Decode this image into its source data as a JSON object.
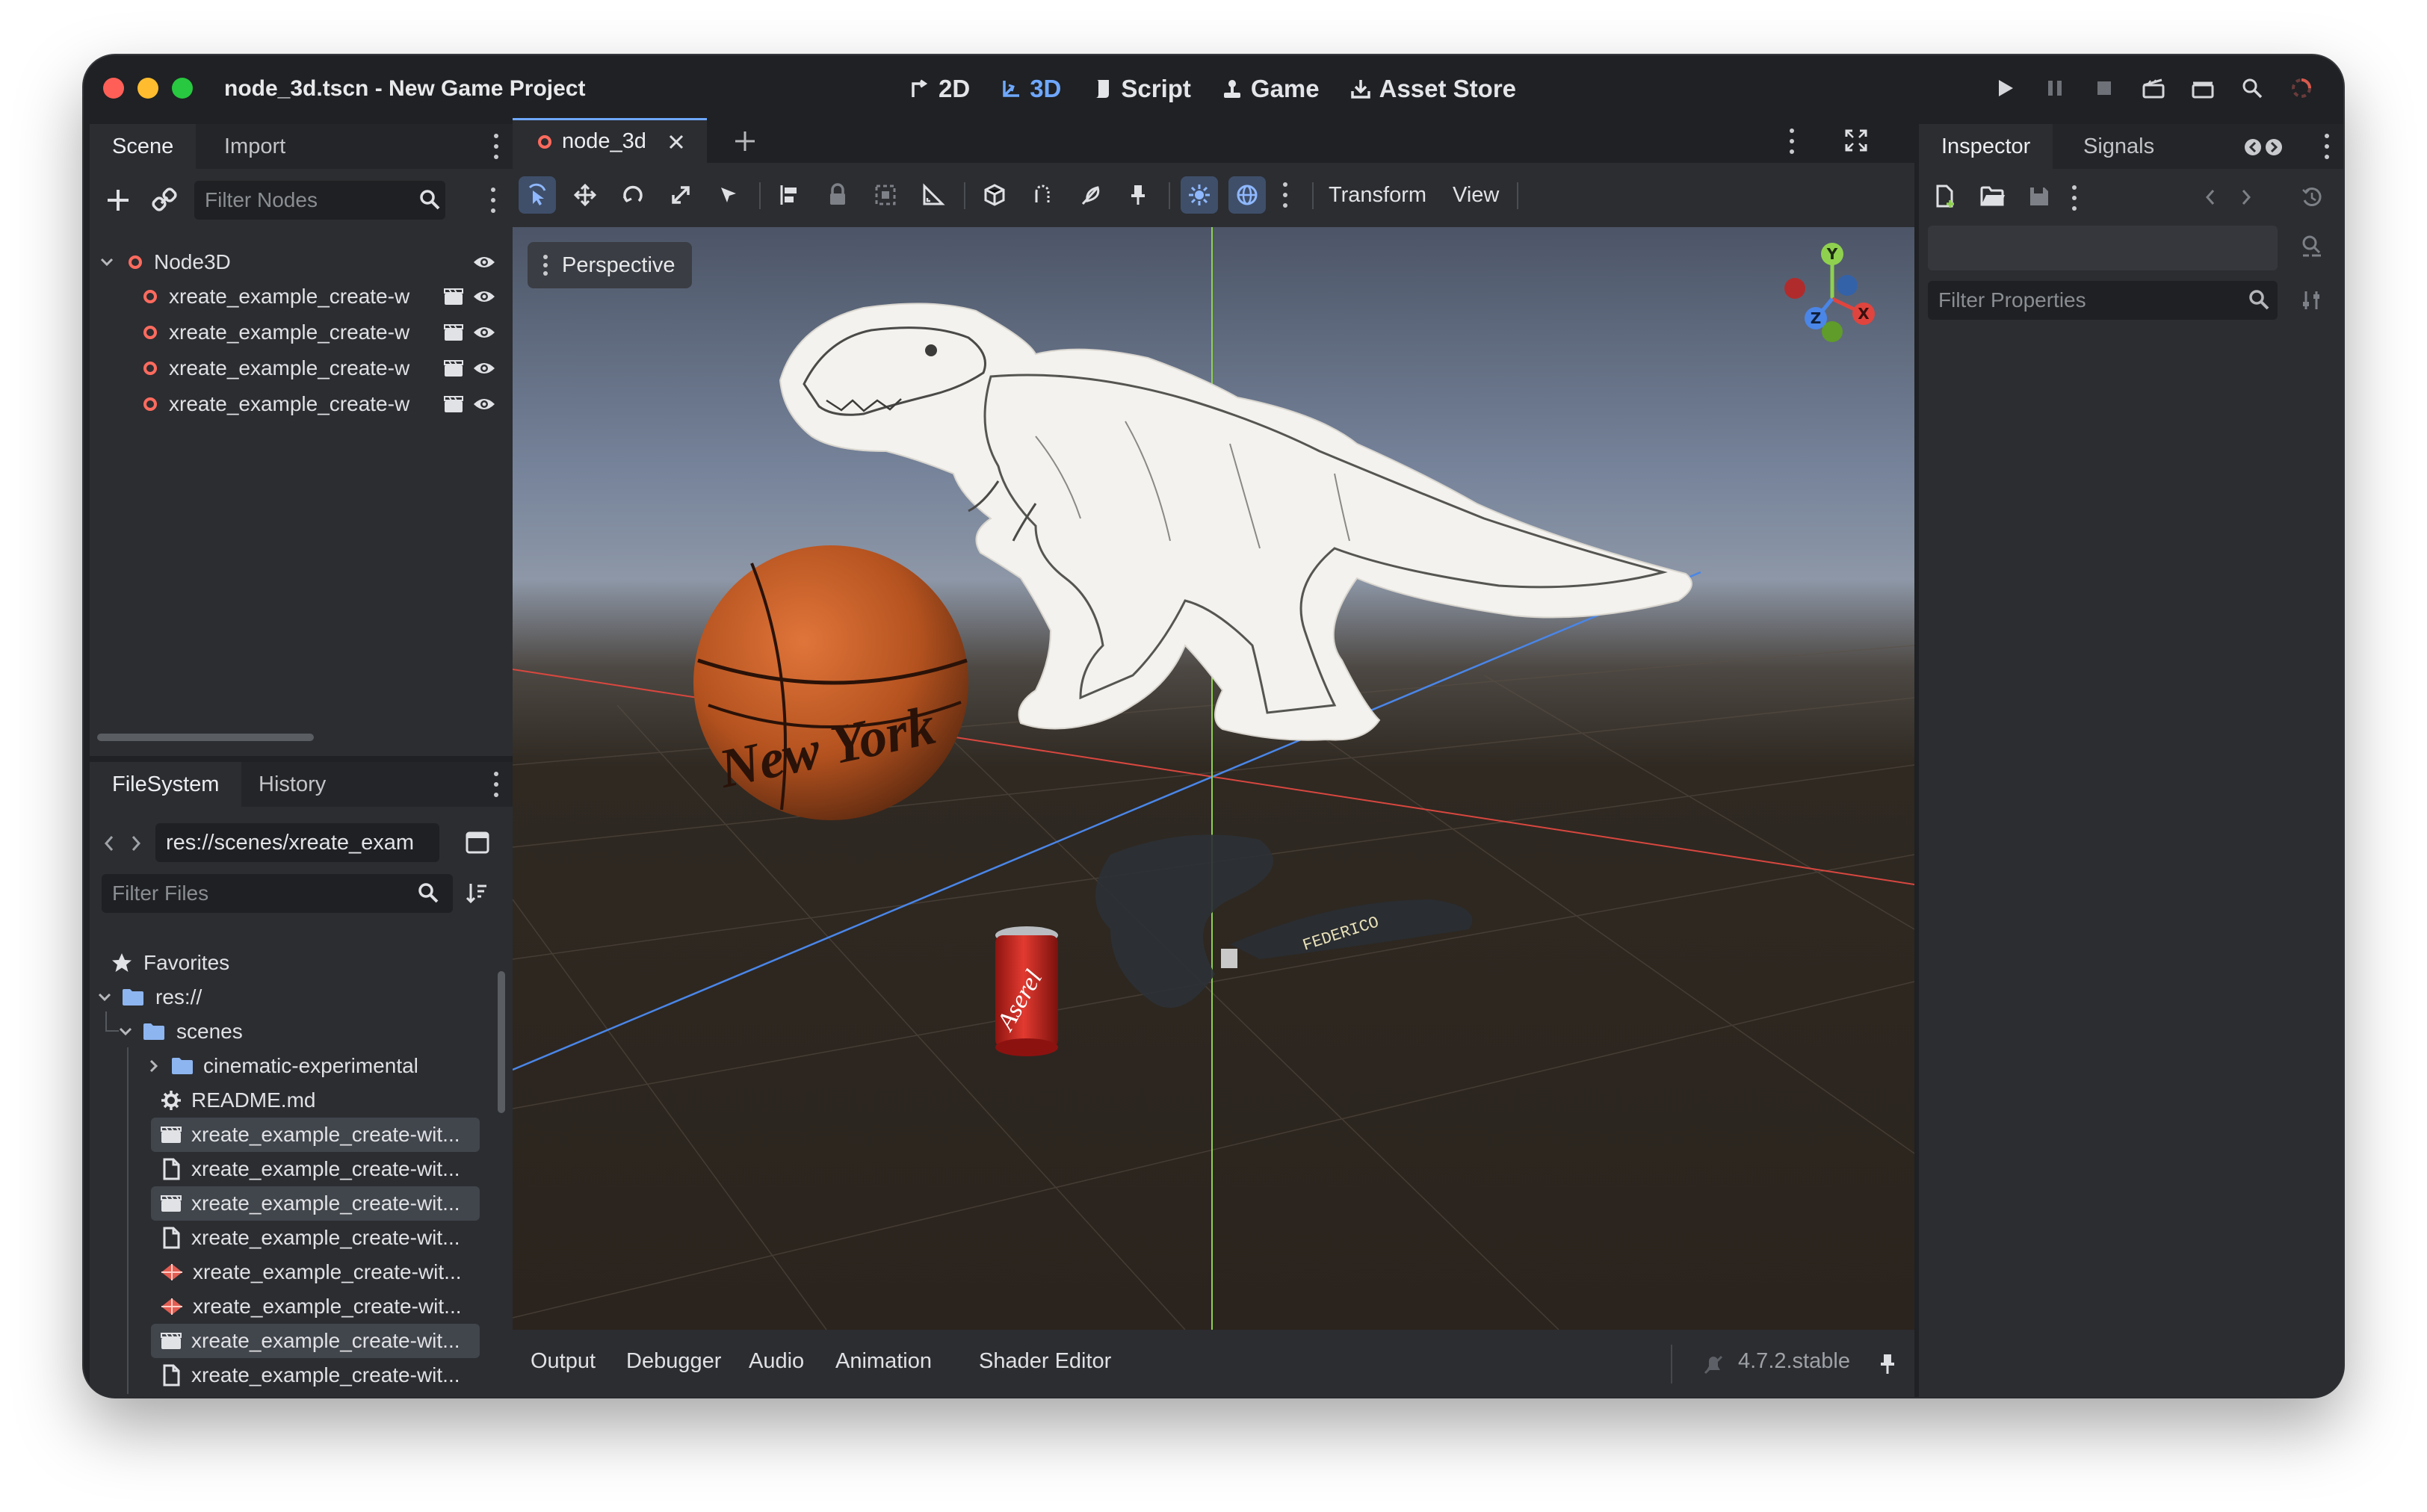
{
  "window": {
    "title": "node_3d.tscn - New Game Project"
  },
  "modes": [
    {
      "label": "2D",
      "icon": "2d-arrow-icon",
      "active": false
    },
    {
      "label": "3D",
      "icon": "3d-axes-icon",
      "active": true
    },
    {
      "label": "Script",
      "icon": "script-icon",
      "active": false
    },
    {
      "label": "Game",
      "icon": "game-joystick-icon",
      "active": false
    },
    {
      "label": "Asset Store",
      "icon": "download-icon",
      "active": false
    }
  ],
  "scene_dock": {
    "tabs": [
      "Scene",
      "Import"
    ],
    "active_tab": "Scene",
    "filter_placeholder": "Filter Nodes",
    "root": "Node3D",
    "children": [
      "xreate_example_create-w",
      "xreate_example_create-w",
      "xreate_example_create-w",
      "xreate_example_create-w"
    ]
  },
  "filesystem_dock": {
    "tabs": [
      "FileSystem",
      "History"
    ],
    "active_tab": "FileSystem",
    "path": "res://scenes/xreate_exam",
    "filter_placeholder": "Filter Files",
    "items": [
      {
        "label": "Favorites",
        "icon": "star-icon",
        "indent": 0,
        "selected": false
      },
      {
        "label": "res://",
        "icon": "folder-icon",
        "indent": 0,
        "selected": false
      },
      {
        "label": "scenes",
        "icon": "folder-icon",
        "indent": 1,
        "selected": false
      },
      {
        "label": "cinematic-experimental",
        "icon": "folder-icon",
        "indent": 2,
        "selected": false
      },
      {
        "label": "README.md",
        "icon": "gear-doc-icon",
        "indent": 2,
        "selected": false
      },
      {
        "label": "xreate_example_create-wit...",
        "icon": "scene-clapper-icon",
        "indent": 2,
        "selected": true
      },
      {
        "label": "xreate_example_create-wit...",
        "icon": "file-icon",
        "indent": 2,
        "selected": false
      },
      {
        "label": "xreate_example_create-wit...",
        "icon": "scene-clapper-icon",
        "indent": 2,
        "selected": true
      },
      {
        "label": "xreate_example_create-wit...",
        "icon": "file-icon",
        "indent": 2,
        "selected": false
      },
      {
        "label": "xreate_example_create-wit...",
        "icon": "mesh-icon",
        "indent": 2,
        "selected": false
      },
      {
        "label": "xreate_example_create-wit...",
        "icon": "mesh-icon",
        "indent": 2,
        "selected": false
      },
      {
        "label": "xreate_example_create-wit...",
        "icon": "scene-clapper-icon",
        "indent": 2,
        "selected": true
      },
      {
        "label": "xreate_example_create-wit...",
        "icon": "file-icon",
        "indent": 2,
        "selected": false
      }
    ]
  },
  "editor": {
    "tab_label": "node_3d",
    "toolbar": {
      "transform_label": "Transform",
      "view_label": "View"
    },
    "viewport": {
      "perspective_label": "Perspective",
      "gizmo": {
        "y": "Y",
        "z": "Z",
        "x": "X"
      },
      "basketball_text": "New York",
      "can_text": "Aserel",
      "glasses_text": "FEDERICO"
    },
    "bottom_tabs": [
      "Output",
      "Debugger",
      "Audio",
      "Animation",
      "Shader Editor"
    ],
    "version": "4.7.2.stable"
  },
  "inspector": {
    "tabs": [
      "Inspector",
      "Signals"
    ],
    "active_tab": "Inspector",
    "filter_placeholder": "Filter Properties"
  },
  "colors": {
    "accent": "#6fa8ff",
    "node_ring": "#ff6b5e",
    "axis_x": "#e0443e",
    "axis_y": "#8fd14f",
    "axis_z": "#4a86e8"
  }
}
